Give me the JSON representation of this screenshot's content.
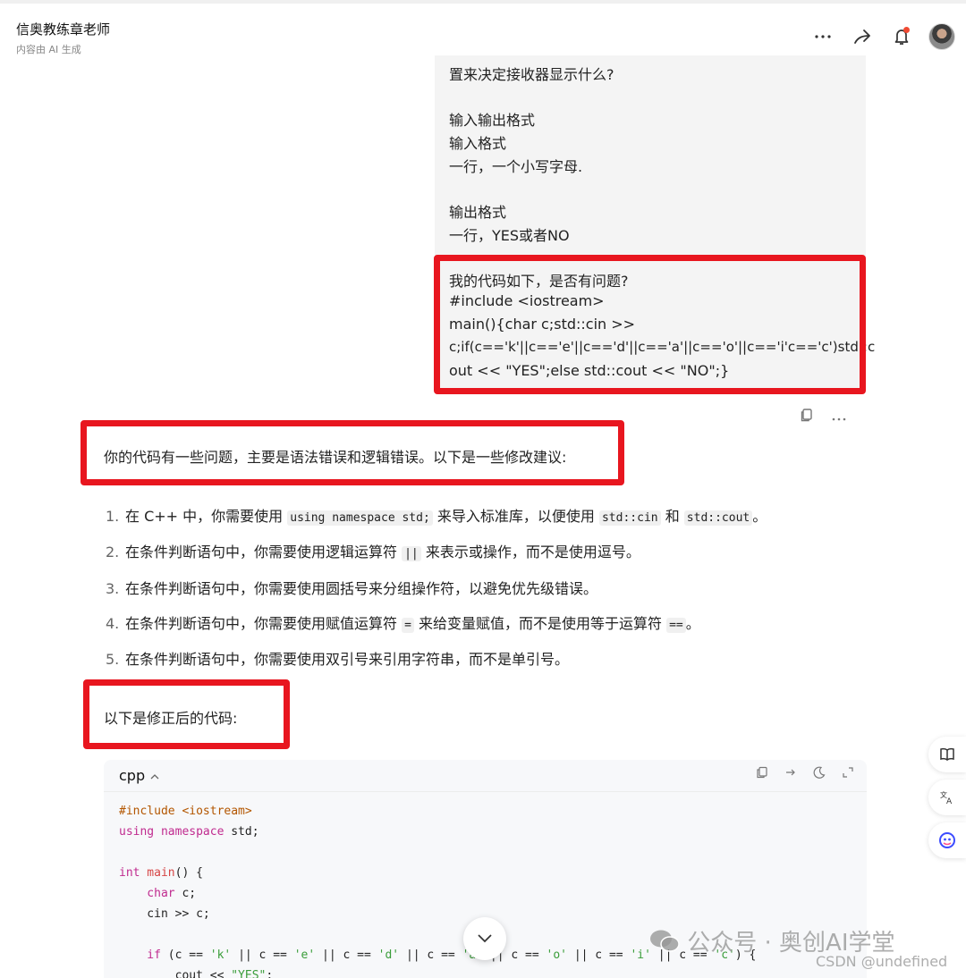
{
  "header": {
    "title": "信奥教练章老师",
    "subtitle": "内容由 AI 生成",
    "more_icon": "more-horizontal-icon",
    "share_icon": "share-icon",
    "bell_icon": "bell-icon"
  },
  "user_message": {
    "lines": [
      "置来决定接收器显示什么?",
      "输入输出格式",
      "输入格式",
      "一行，一个小写字母.",
      "输出格式",
      "一行，YES或者NO",
      "我的代码如下，是否有问题?",
      "#include <iostream>",
      "main(){char c;std::cin >>",
      "c;if(c=='k'||c=='e'||c=='d'||c=='a'||c=='o'||c=='i'c=='c')std::c",
      "out << \"YES\";else std::cout << \"NO\";}"
    ],
    "copy_icon": "copy-icon",
    "more_icon": "more-horizontal-icon"
  },
  "answer": {
    "intro": "你的代码有一些问题，主要是语法错误和逻辑错误。以下是一些修改建议:",
    "items": [
      {
        "num": "1.",
        "parts": [
          "在 C++ 中，你需要使用 ",
          "using namespace std;",
          " 来导入标准库，以便使用 ",
          "std::cin",
          " 和 ",
          "std::cout",
          "。"
        ]
      },
      {
        "num": "2.",
        "parts": [
          "在条件判断语句中，你需要使用逻辑运算符 ",
          "||",
          " 来表示或操作，而不是使用逗号。"
        ]
      },
      {
        "num": "3.",
        "parts": [
          "在条件判断语句中，你需要使用圆括号来分组操作符，以避免优先级错误。"
        ]
      },
      {
        "num": "4.",
        "parts": [
          "在条件判断语句中，你需要使用赋值运算符 ",
          "=",
          " 来给变量赋值，而不是使用等于运算符 ",
          "==",
          "。"
        ]
      },
      {
        "num": "5.",
        "parts": [
          "在条件判断语句中，你需要使用双引号来引用字符串，而不是单引号。"
        ]
      }
    ],
    "code_intro": "以下是修正后的代码:"
  },
  "code_block": {
    "language": "cpp",
    "lines": {
      "l1_pp": "#include <iostream>",
      "l2_kw": "using namespace",
      "l2_rest": " std;",
      "l3_kw": "int",
      "l3_fn": " main",
      "l3_rest": "() {",
      "l4_kw": "    char",
      "l4_rest": " c;",
      "l5": "    cin >> c;",
      "l6_kw": "    if",
      "l6_a": " (c == ",
      "l6_s1": "'k'",
      "l6_b": " || c == ",
      "l6_s2": "'e'",
      "l6_c": " || c == ",
      "l6_s3": "'d'",
      "l6_d": " || c == ",
      "l6_s4": "'a'",
      "l6_e": " || c == ",
      "l6_s5": "'o'",
      "l6_f": " || c == ",
      "l6_s6": "'i'",
      "l6_g": " || c == ",
      "l6_s7": "'c'",
      "l6_h": ") {",
      "l7_a": "        cout << ",
      "l7_s": "\"YES\"",
      "l7_b": ";"
    }
  },
  "side_tools": [
    "book-icon",
    "translate-icon",
    "ai-assistant-icon"
  ],
  "watermark": {
    "main": "公众号 · 奥创AI学堂",
    "sub": "CSDN @undefined"
  }
}
